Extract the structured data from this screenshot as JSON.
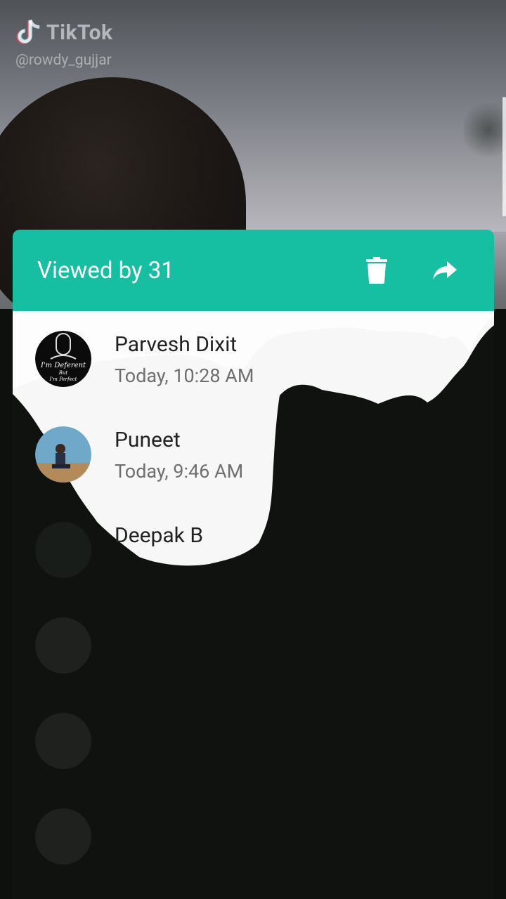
{
  "watermark": {
    "brand": "TikTok",
    "handle": "@rowdy_gujjar"
  },
  "dialog": {
    "title": "Viewed by 31",
    "icons": {
      "delete": "trash-icon",
      "share": "share-forward-icon"
    },
    "accent_color": "#16bfa2"
  },
  "viewers": [
    {
      "name": "Parvesh Dixit",
      "time": "Today, 10:28 AM",
      "avatar_text": "I'm Deferent But I'm Perfect"
    },
    {
      "name": "Puneet",
      "time": "Today, 9:46 AM"
    },
    {
      "name": "Deepak B",
      "time": ""
    },
    {
      "name": "",
      "time": ""
    },
    {
      "name": "",
      "time": ""
    },
    {
      "name": "",
      "time": ""
    }
  ]
}
